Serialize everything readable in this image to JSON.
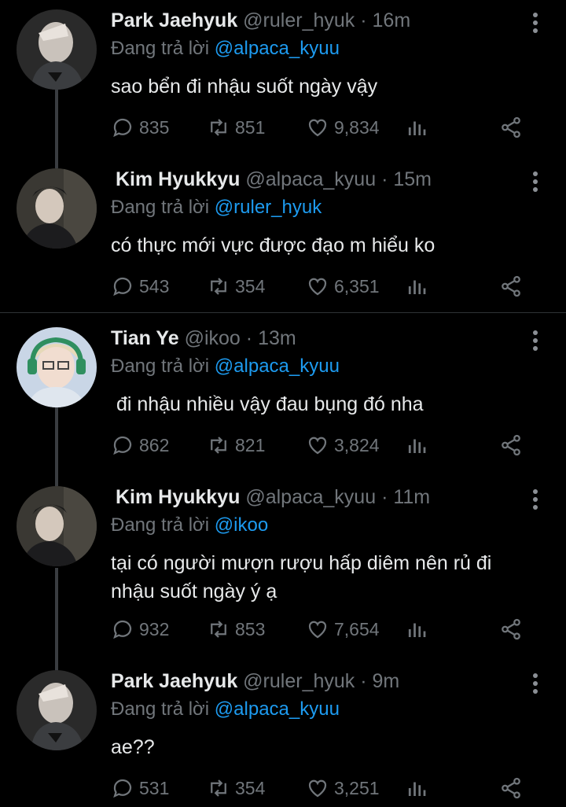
{
  "reply_prefix": "Đang trả lời",
  "tweets": [
    {
      "name": "Park Jaehyuk",
      "handle": "@ruler_hyuk",
      "dot": "·",
      "time": "16m",
      "reply_to": "@alpaca_kyuu",
      "text_lines": [
        "sao bển đi nhậu suốt ngày vậy"
      ],
      "replies": "835",
      "retweets": "851",
      "likes": "9,834"
    },
    {
      "name": "Kim Hyukkyu",
      "handle": "@alpaca_kyuu",
      "dot": "·",
      "time": "15m",
      "reply_to": "@ruler_hyuk",
      "text_lines": [
        "có thực mới vực được đạo m hiểu ko"
      ],
      "replies": "543",
      "retweets": "354",
      "likes": "6,351"
    },
    {
      "name": "Tian Ye",
      "handle": "@ikoo",
      "dot": "·",
      "time": "13m",
      "reply_to": "@alpaca_kyuu",
      "text_lines": [
        " đi nhậu nhiều vậy đau bụng đó nha"
      ],
      "replies": "862",
      "retweets": "821",
      "likes": "3,824"
    },
    {
      "name": "Kim Hyukkyu",
      "handle": "@alpaca_kyuu",
      "dot": "·",
      "time": "11m",
      "reply_to": "@ikoo",
      "text_lines": [
        "tại có người mượn rượu hấp diêm nên rủ đi",
        "nhậu suốt ngày ý ạ"
      ],
      "replies": "932",
      "retweets": "853",
      "likes": "7,654"
    },
    {
      "name": "Park Jaehyuk",
      "handle": "@ruler_hyuk",
      "dot": "·",
      "time": "9m",
      "reply_to": "@alpaca_kyuu",
      "text_lines": [
        "ae??"
      ],
      "replies": "531",
      "retweets": "354",
      "likes": "3,251"
    }
  ],
  "icons": {
    "reply": "reply-icon",
    "retweet": "retweet-icon",
    "like": "heart-icon",
    "views": "views-icon",
    "share": "share-icon",
    "more": "more-options-icon"
  }
}
